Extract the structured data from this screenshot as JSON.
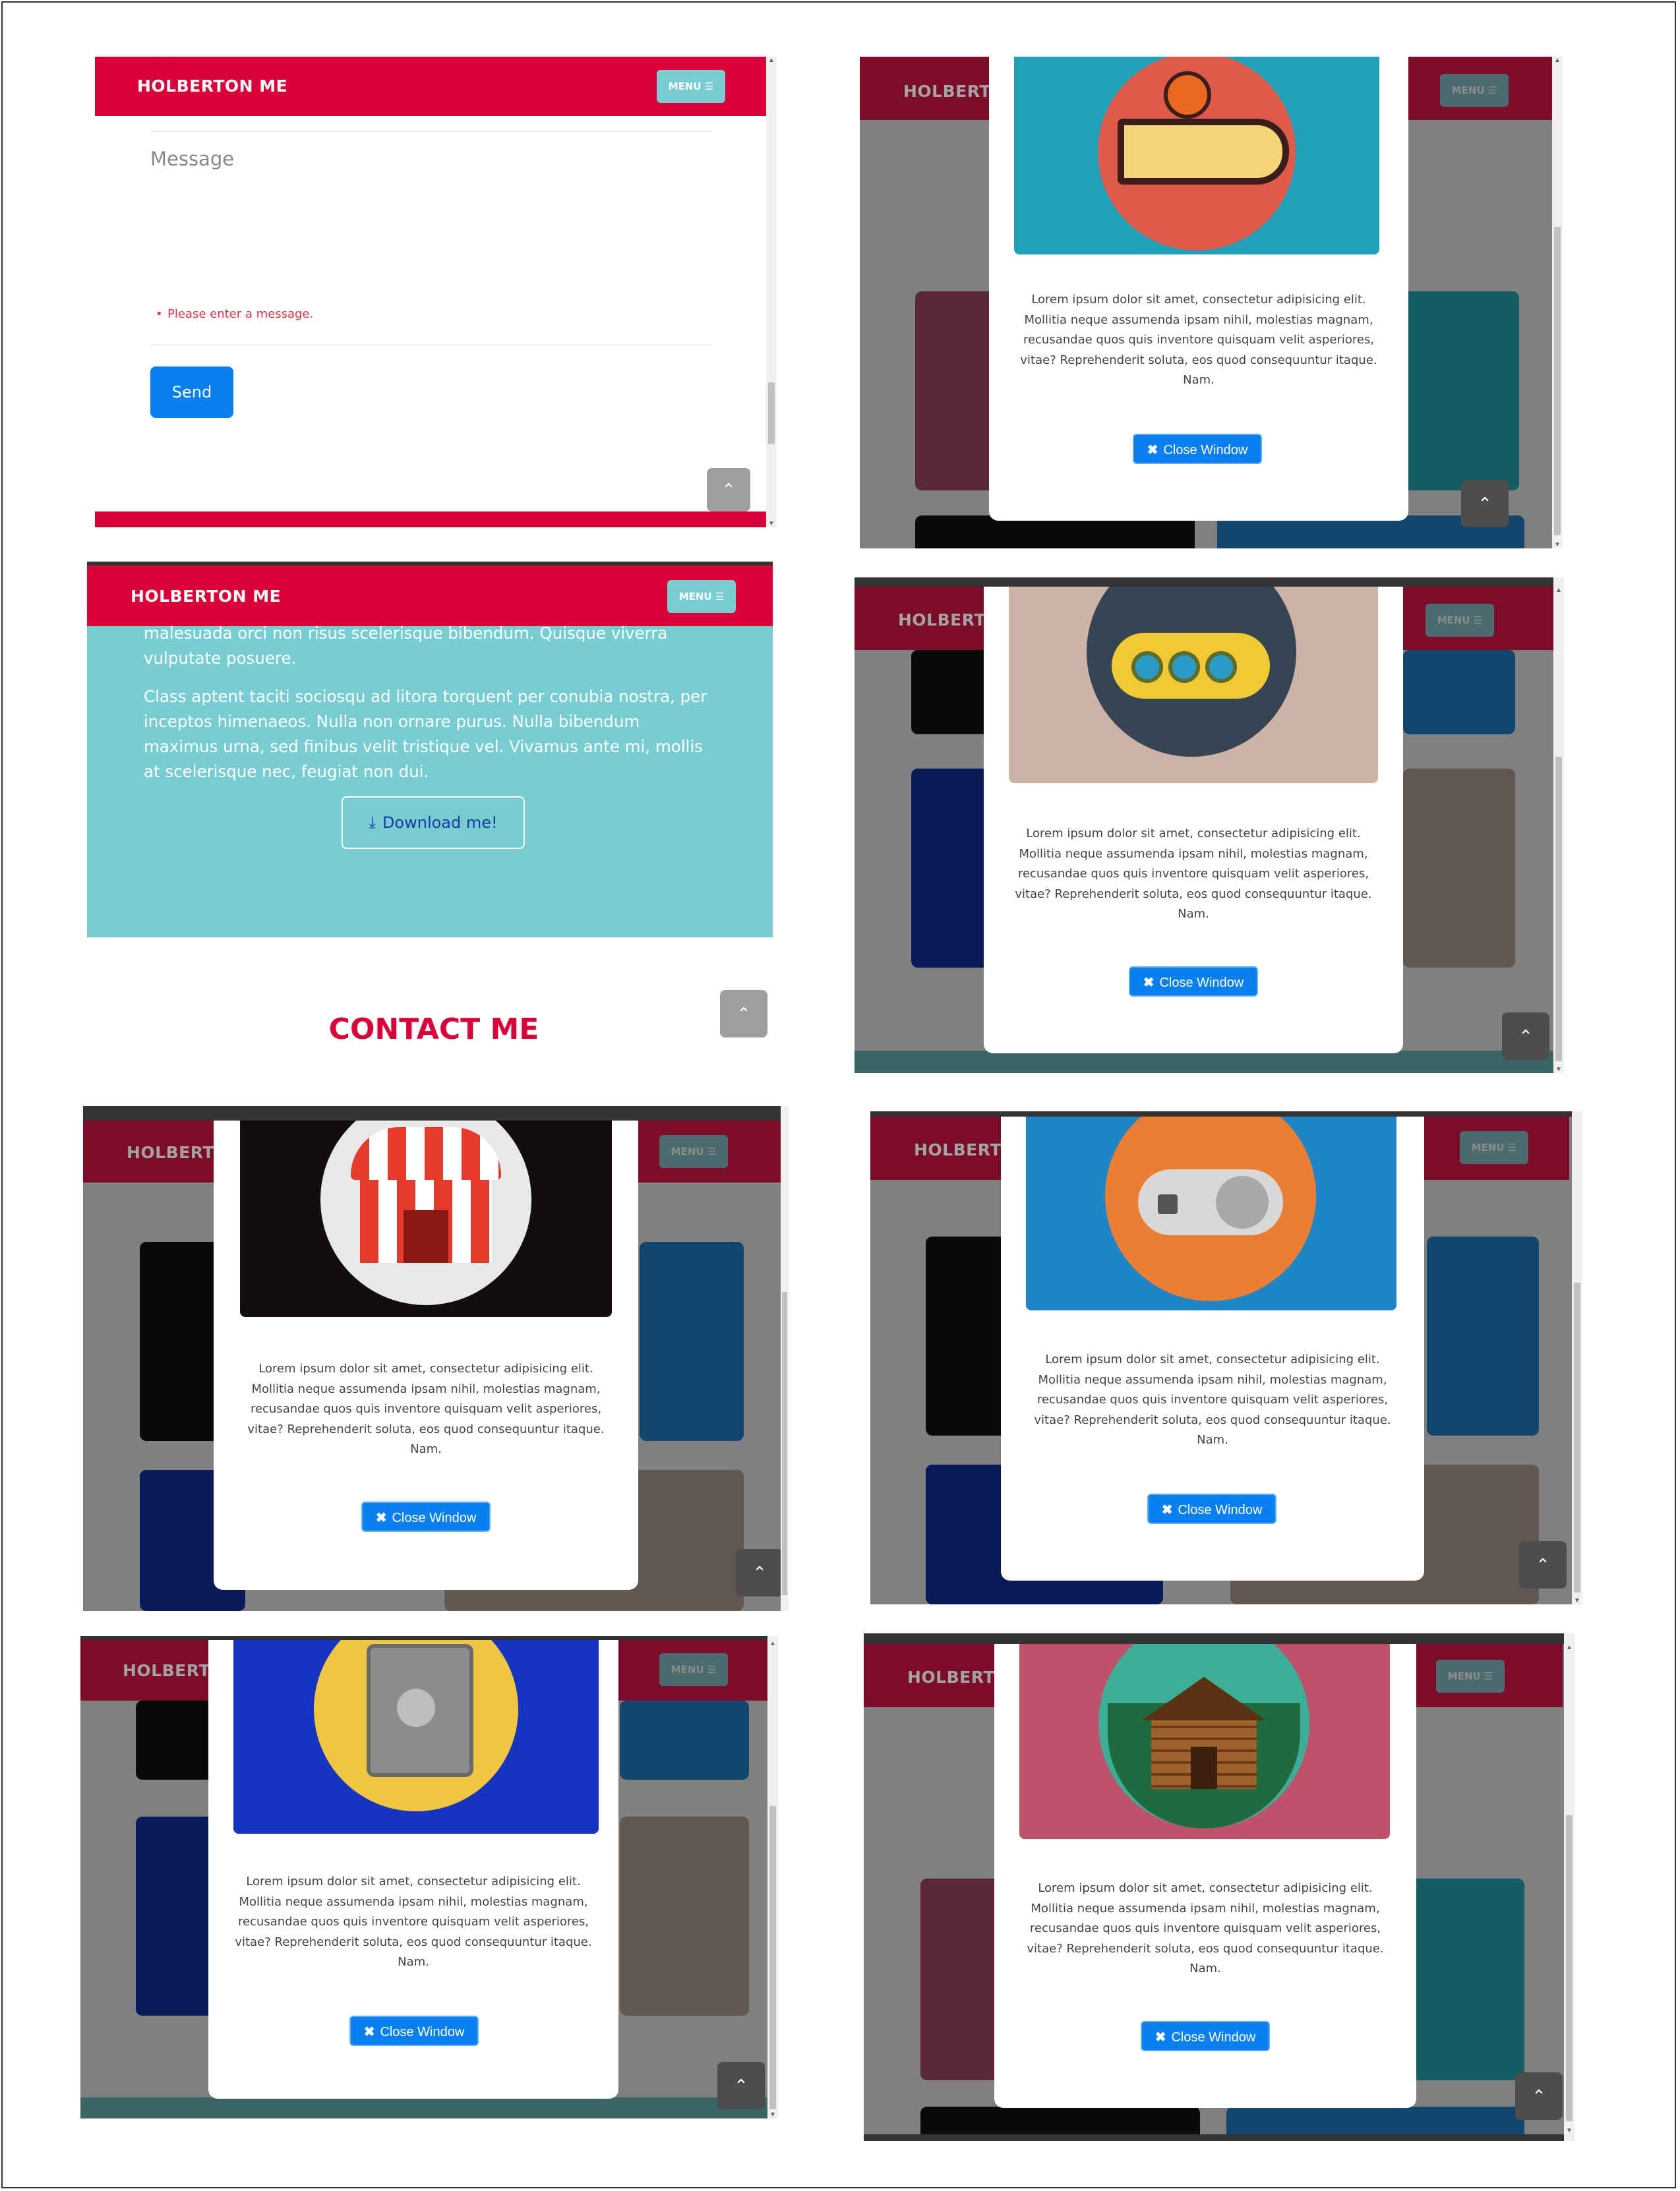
{
  "brand": "HOLBERTON ME",
  "menu_label": "MENU ☰",
  "up_icon": "chevron-up-icon",
  "contact_form": {
    "message_placeholder": "Message",
    "error": "Please enter a message.",
    "send_label": "Send"
  },
  "about": {
    "paragraph_1": "malesuada orci non risus scelerisque bibendum. Quisque viverra vulputate posuere.",
    "paragraph_2": "Class aptent taciti sociosqu ad litora torquent per conubia nostra, per inceptos himenaeos. Nulla non ornare purus. Nulla bibendum maximus urna, sed finibus velit tristique vel. Vivamus ante mi, mollis at scelerisque nec, feugiat non dui.",
    "download_label": "Download me!",
    "contact_heading": "CONTACT ME"
  },
  "modal": {
    "lines": [
      "Lorem ipsum dolor sit amet, consectetur adipisicing elit.",
      "Mollitia neque assumenda ipsam nihil, molestias magnam,",
      "recusandae quos quis inventore quisquam velit asperiores,",
      "vitae? Reprehenderit soluta, eos quod consequuntur itaque.",
      "Nam."
    ],
    "close_label": "Close Window"
  },
  "modals": [
    {
      "image": "cake-icon",
      "bg": "#21a1b8",
      "circle": "#e05a4a"
    },
    {
      "image": "submarine-icon",
      "bg": "#cdb3a5",
      "circle": "#354554"
    },
    {
      "image": "circus-tent-icon",
      "bg": "#120e0e",
      "circle": "#e8e8e8"
    },
    {
      "image": "game-controller-icon",
      "bg": "#1e85c8",
      "circle": "#ec7e34"
    },
    {
      "image": "safe-icon",
      "bg": "#1634c1",
      "circle": "#f0c540"
    },
    {
      "image": "log-cabin-icon",
      "bg": "#c0516a",
      "circle": "#3cae97"
    }
  ],
  "colors": {
    "brand": "#dc0039",
    "accent": "#77cdd1",
    "primary": "#0a7ff2",
    "error": "#dc3545"
  }
}
